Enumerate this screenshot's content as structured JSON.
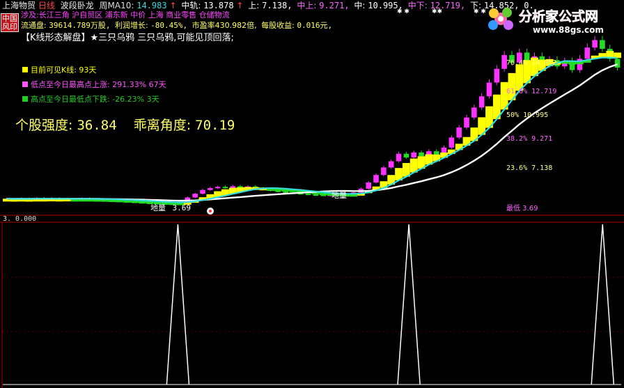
{
  "header": {
    "stock": "上海物贸",
    "period": "日线",
    "indicator": "波段卧龙",
    "weekma_label": "周MA10:",
    "weekma_value": "14.983",
    "mid_label": "中轨:",
    "mid_value": "13.878",
    "up_label": "上:",
    "up_value": "7.138,",
    "midup_label": "中上:",
    "midup_value": "9.271,",
    "midc_label": "中:",
    "midc_value": "10.995,",
    "middown_label": "中下:",
    "middown_value": "12.719,",
    "down_label": "下:",
    "down_value": "14.852,",
    "tail": "0."
  },
  "stamp": {
    "line1": "中国",
    "line2": "风印"
  },
  "logo": {
    "title": "分析家公式网",
    "url": "www.88gs.com"
  },
  "concept_line": "涉及:长江三角 沪自贸区 浦东新 中价 上海 商业零售 仓储物流",
  "info_line": {
    "float_label": "流通盘:",
    "float_value": "39614.789万股,",
    "profit_label": "利润增长:",
    "profit_value": "-80.45%,",
    "pe_label": "市盈率430.982倍,",
    "eps_label": "每股收益:",
    "eps_value": "0.016元,"
  },
  "pattern_line": "【K线形态解盘】★三只乌鸦 三只乌鸦,可能见顶回落;",
  "legend": [
    {
      "text": "目前可见K线: 93天",
      "color": "#ffff00"
    },
    {
      "text": "低点至今日最高点上涨: 291.33% 67天",
      "color": "#ff55ff"
    },
    {
      "text": "高点至今日最低点下跌: -26.23% 3天",
      "color": "#22cc22"
    }
  ],
  "strength": {
    "label1": "个股强度:",
    "value1": "36.84",
    "label2": "乖离角度:",
    "value2": "70.19"
  },
  "fib_levels": [
    {
      "text": "76.4%  14.852"
    },
    {
      "text": "61.8%  12.719"
    },
    {
      "text": "50%  10.995"
    },
    {
      "text": "38.2%  9.271"
    },
    {
      "text": "23.6%  7.138"
    },
    {
      "text": "最低  3.69"
    }
  ],
  "annotations": {
    "ground1": "地量",
    "ground1_value": "3.69",
    "ground2": "地量"
  },
  "lower_panel": {
    "label": "3. 0.000"
  },
  "colors": {
    "bullish": "#ff33ff",
    "bearish": "#22dd22",
    "band": "#ffff00",
    "ma_cyan": "#33dddd",
    "ma_white": "#ffffff",
    "fib": "#ffff88",
    "grid_red": "#b00000"
  },
  "chart_data": [
    {
      "type": "line",
      "title": "",
      "series": [
        {
          "name": "中上",
          "values": [
            9.271
          ]
        },
        {
          "name": "中",
          "values": [
            10.995
          ]
        },
        {
          "name": "中下",
          "values": [
            12.719
          ]
        },
        {
          "name": "下",
          "values": [
            14.852
          ]
        }
      ],
      "lowest": 3.69,
      "candles": [
        {
          "o": 4.05,
          "c": 4.1
        },
        {
          "o": 4.1,
          "c": 4.08
        },
        {
          "o": 4.08,
          "c": 4.12
        },
        {
          "o": 4.12,
          "c": 4.06
        },
        {
          "o": 4.06,
          "c": 4.15
        },
        {
          "o": 4.15,
          "c": 4.1
        },
        {
          "o": 4.1,
          "c": 4.13
        },
        {
          "o": 4.13,
          "c": 4.07
        },
        {
          "o": 4.07,
          "c": 4.1
        },
        {
          "o": 4.1,
          "c": 4.05
        },
        {
          "o": 4.05,
          "c": 4.12
        },
        {
          "o": 4.12,
          "c": 4.08
        },
        {
          "o": 4.08,
          "c": 4.02
        },
        {
          "o": 4.02,
          "c": 3.98
        },
        {
          "o": 3.98,
          "c": 3.94
        },
        {
          "o": 3.94,
          "c": 3.9
        },
        {
          "o": 3.9,
          "c": 3.86
        },
        {
          "o": 3.86,
          "c": 3.82
        },
        {
          "o": 3.82,
          "c": 3.78
        },
        {
          "o": 3.78,
          "c": 3.75
        },
        {
          "o": 3.75,
          "c": 3.72
        },
        {
          "o": 3.72,
          "c": 3.7
        },
        {
          "o": 3.7,
          "c": 3.74
        },
        {
          "o": 3.74,
          "c": 3.85
        },
        {
          "o": 3.85,
          "c": 4.2
        },
        {
          "o": 4.2,
          "c": 4.5
        },
        {
          "o": 4.5,
          "c": 4.8
        },
        {
          "o": 4.8,
          "c": 4.95
        },
        {
          "o": 4.95,
          "c": 5.05
        },
        {
          "o": 5.05,
          "c": 4.98
        },
        {
          "o": 4.98,
          "c": 5.1
        },
        {
          "o": 5.1,
          "c": 5.0
        },
        {
          "o": 5.0,
          "c": 5.08
        },
        {
          "o": 5.08,
          "c": 4.95
        },
        {
          "o": 4.95,
          "c": 4.85
        },
        {
          "o": 4.85,
          "c": 4.75
        },
        {
          "o": 4.75,
          "c": 4.68
        },
        {
          "o": 4.68,
          "c": 4.6
        },
        {
          "o": 4.6,
          "c": 4.55
        },
        {
          "o": 4.55,
          "c": 4.5
        },
        {
          "o": 4.5,
          "c": 4.45
        },
        {
          "o": 4.45,
          "c": 4.42
        },
        {
          "o": 4.42,
          "c": 4.4
        },
        {
          "o": 4.4,
          "c": 4.42
        },
        {
          "o": 4.42,
          "c": 4.45
        },
        {
          "o": 4.45,
          "c": 4.5
        },
        {
          "o": 4.5,
          "c": 4.6
        },
        {
          "o": 4.6,
          "c": 4.9
        },
        {
          "o": 4.9,
          "c": 5.4
        },
        {
          "o": 5.4,
          "c": 6.0
        },
        {
          "o": 6.0,
          "c": 6.6
        },
        {
          "o": 6.6,
          "c": 7.1
        },
        {
          "o": 7.1,
          "c": 7.7
        },
        {
          "o": 7.7,
          "c": 7.4
        },
        {
          "o": 7.4,
          "c": 7.8
        },
        {
          "o": 7.8,
          "c": 7.5
        },
        {
          "o": 7.5,
          "c": 7.9
        },
        {
          "o": 7.9,
          "c": 7.6
        },
        {
          "o": 7.6,
          "c": 8.2
        },
        {
          "o": 8.2,
          "c": 9.0
        },
        {
          "o": 9.0,
          "c": 9.8
        },
        {
          "o": 9.8,
          "c": 10.6
        },
        {
          "o": 10.6,
          "c": 11.4
        },
        {
          "o": 11.4,
          "c": 12.3
        },
        {
          "o": 12.3,
          "c": 13.4
        },
        {
          "o": 13.4,
          "c": 14.5
        },
        {
          "o": 14.5,
          "c": 15.6
        },
        {
          "o": 15.6,
          "c": 15.0
        },
        {
          "o": 15.0,
          "c": 15.8
        },
        {
          "o": 15.8,
          "c": 15.1
        },
        {
          "o": 15.1,
          "c": 15.5
        },
        {
          "o": 15.5,
          "c": 14.8
        },
        {
          "o": 14.8,
          "c": 15.2
        },
        {
          "o": 15.2,
          "c": 14.7
        },
        {
          "o": 14.7,
          "c": 15.1
        },
        {
          "o": 15.1,
          "c": 14.4
        },
        {
          "o": 14.4,
          "c": 15.3
        },
        {
          "o": 15.3,
          "c": 16.2
        },
        {
          "o": 16.2,
          "c": 16.8
        },
        {
          "o": 16.8,
          "c": 16.1
        },
        {
          "o": 16.1,
          "c": 15.3
        },
        {
          "o": 15.3,
          "c": 14.6
        }
      ],
      "ylim": [
        3.0,
        17.5
      ]
    },
    {
      "type": "line",
      "title": "",
      "ylim": [
        0,
        3
      ],
      "spikes": [
        {
          "index": 23,
          "value": 3
        },
        {
          "index": 54,
          "value": 3
        },
        {
          "index": 80,
          "value": 3
        }
      ],
      "length": 83
    }
  ]
}
